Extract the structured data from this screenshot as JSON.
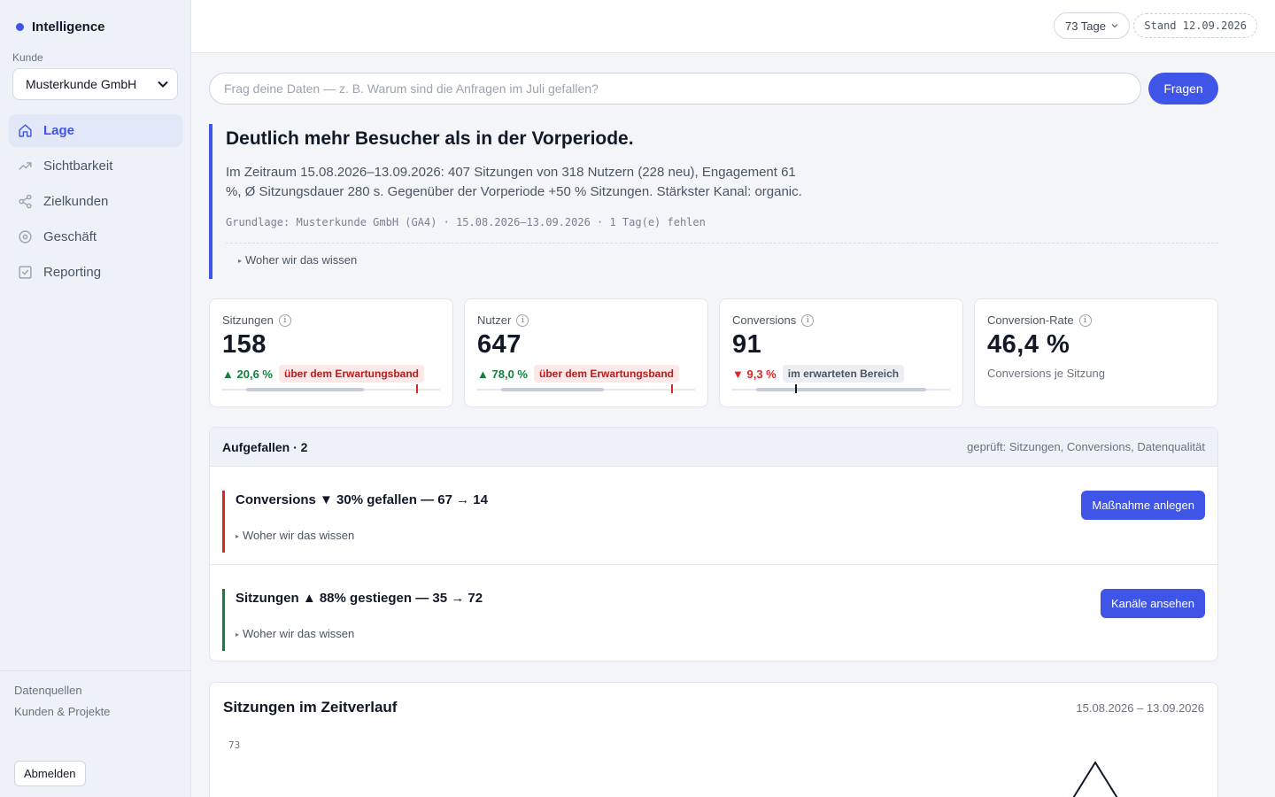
{
  "sidebar": {
    "brand": "Intelligence",
    "kunde_label": "Kunde",
    "kunde_value": "Musterkunde GmbH",
    "nav": [
      {
        "label": "Lage",
        "icon": "home-icon",
        "active": true
      },
      {
        "label": "Sichtbarkeit",
        "icon": "trending-up-icon",
        "active": false
      },
      {
        "label": "Zielkunden",
        "icon": "share-icon",
        "active": false
      },
      {
        "label": "Geschäft",
        "icon": "target-icon",
        "active": false
      },
      {
        "label": "Reporting",
        "icon": "checkbox-icon",
        "active": false
      }
    ],
    "footer_links": [
      "Datenquellen",
      "Kunden & Projekte"
    ],
    "logout": "Abmelden"
  },
  "topbar": {
    "period": "73 Tage",
    "stand": "Stand 12.09.2026"
  },
  "ask": {
    "placeholder": "Frag deine Daten — z. B. Warum sind die Anfragen im Juli gefallen?",
    "button": "Fragen"
  },
  "headline": {
    "title": "Deutlich mehr Besucher als in der Vorperiode.",
    "text": "Im Zeitraum 15.08.2026–13.09.2026: 407 Sitzungen von 318 Nutzern (228 neu), Engagement 61 %, Ø Sitzungsdauer 280 s. Gegenüber der Vorperiode +50 % Sitzungen. Stärkster Kanal: organic.",
    "basis": "Grundlage: Musterkunde GmbH (GA4) · 15.08.2026–13.09.2026 · 1 Tag(e) fehlen",
    "why": "Woher wir das wissen"
  },
  "kpis": [
    {
      "label": "Sitzungen",
      "value": "158",
      "delta": "20,6 %",
      "direction": "up",
      "badge": "über dem Erwartungsband",
      "badge_type": "red",
      "band_range": [
        0.11,
        0.65
      ],
      "marker": 0.89,
      "marker_color": "#dc2626"
    },
    {
      "label": "Nutzer",
      "value": "647",
      "delta": "78,0 %",
      "direction": "up",
      "badge": "über dem Erwartungsband",
      "badge_type": "red",
      "band_range": [
        0.11,
        0.58
      ],
      "marker": 0.89,
      "marker_color": "#dc2626"
    },
    {
      "label": "Conversions",
      "value": "91",
      "delta": "9,3 %",
      "direction": "down",
      "badge": "im erwarteten Bereich",
      "badge_type": "gray",
      "band_range": [
        0.11,
        0.89
      ],
      "marker": 0.29,
      "marker_color": "#111827"
    },
    {
      "label": "Conversion-Rate",
      "value": "46,4 %",
      "sub": "Conversions je Sitzung"
    }
  ],
  "findings": {
    "title": "Aufgefallen · 2",
    "meta": "geprüft: Sitzungen, Conversions, Datenqualität",
    "items": [
      {
        "text": "Conversions ▼ 30% gefallen — 67 → 14",
        "why": "Woher wir das wissen",
        "button": "Maßnahme anlegen",
        "color": "#dc2626"
      },
      {
        "text": "Sitzungen ▲ 88% gestiegen — 35 → 72",
        "why": "Woher wir das wissen",
        "button": "Kanäle ansehen",
        "color": "#15803d"
      }
    ]
  },
  "chart": {
    "title": "Sitzungen im Zeitverlauf",
    "range": "15.08.2026 – 13.09.2026",
    "ytick_top": "73"
  },
  "chart_data": {
    "type": "line",
    "title": "Sitzungen im Zeitverlauf",
    "xlabel": "",
    "ylabel": "",
    "ylim": [
      0,
      73
    ],
    "x": [
      "15.08.2026",
      "13.09.2026"
    ],
    "values": [],
    "peak": {
      "value": 73
    }
  }
}
